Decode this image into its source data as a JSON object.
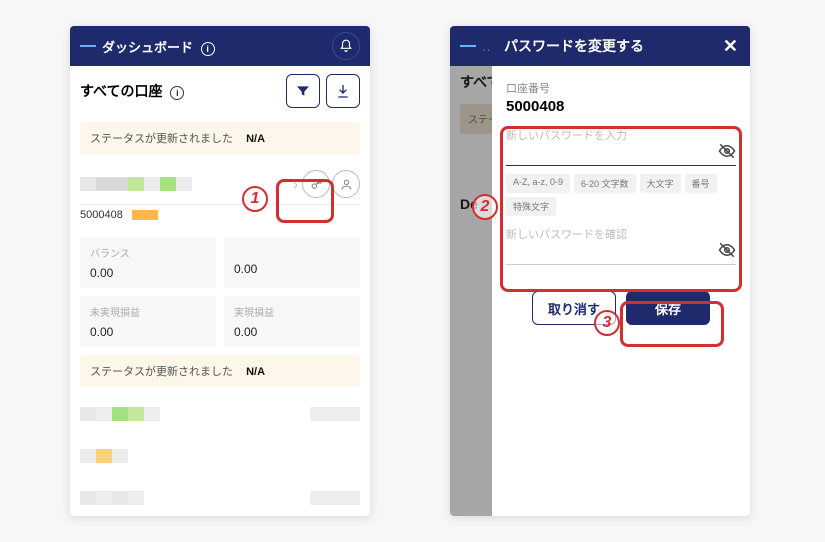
{
  "left": {
    "header_title": "ダッシュボード",
    "section_title": "すべての口座",
    "status_text": "ステータスが更新されました",
    "status_value": "N/A",
    "account_number": "5000408",
    "cards": {
      "balance_label": "バランス",
      "balance_value": "0.00",
      "blank_value": "0.00",
      "unrealized_label": "未実現損益",
      "unrealized_value": "0.00",
      "realized_label": "実現損益",
      "realized_value": "0.00"
    }
  },
  "right": {
    "modal_title": "パスワードを変更する",
    "bg_section": "すべて",
    "bg_status_prefix": "ステー",
    "bg_de": "De",
    "acct_label": "口座番号",
    "acct_number": "5000408",
    "pw_new_ph": "新しいパスワードを入力",
    "pw_confirm_ph": "新しいパスワードを確認",
    "chips": [
      "A-Z, a-z, 0-9",
      "6-20 文字数",
      "大文字",
      "番号",
      "特殊文字"
    ],
    "cancel": "取り消す",
    "save": "保存"
  },
  "annotations": {
    "one": "1",
    "two": "2",
    "three": "3"
  }
}
